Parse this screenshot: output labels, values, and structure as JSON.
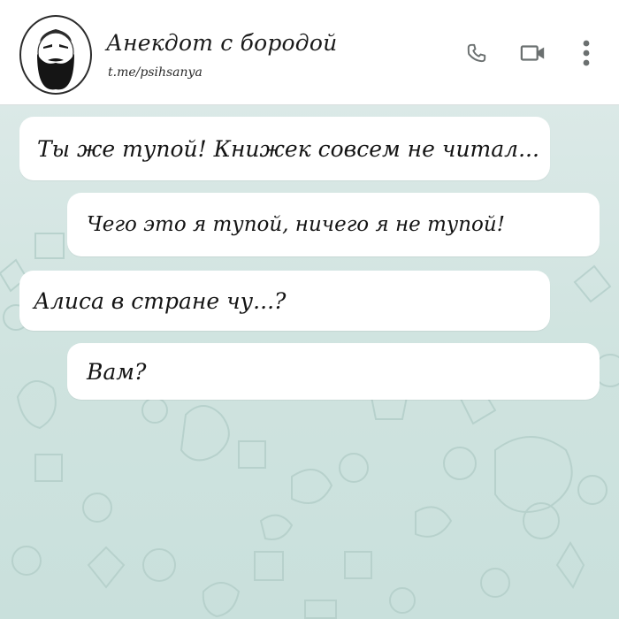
{
  "header": {
    "title": "Анекдот с бородой",
    "subtitle": "t.me/psihsanya",
    "icons": {
      "avatar": "bearded-man-avatar",
      "call": "phone-icon",
      "video": "video-camera-icon",
      "menu": "more-vertical-icon"
    }
  },
  "messages": [
    {
      "side": "left",
      "text": "Ты же тупой! Книжек совсем не читал..."
    },
    {
      "side": "right",
      "text": "Чего это я тупой, ничего я не тупой!"
    },
    {
      "side": "left",
      "text": "Алиса в стране чу...?"
    },
    {
      "side": "right",
      "text": "Вам?"
    }
  ],
  "colors": {
    "header_bg": "#ffffff",
    "chat_bg": "#d3e5e2",
    "bubble_bg": "#ffffff",
    "icon": "#6b7070",
    "text": "#141414"
  }
}
